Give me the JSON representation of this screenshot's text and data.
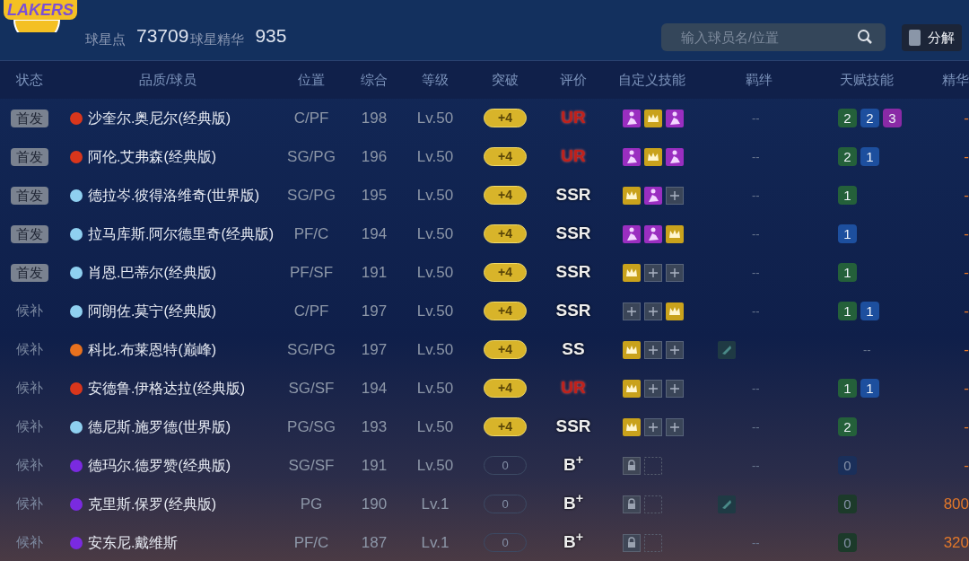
{
  "header": {
    "logo_text": "LAKERS",
    "points_label": "球星点",
    "points": "73709",
    "essence_label": "球星精华",
    "essence": "935",
    "search": {
      "placeholder": "输入球员名/位置"
    },
    "decompose_button": "分解"
  },
  "columns": [
    "状态",
    "品质/球员",
    "位置",
    "综合",
    "等级",
    "突破",
    "评价",
    "自定义技能",
    "羁绊",
    "天赋技能",
    "精华"
  ],
  "rows": [
    {
      "status": "首发",
      "starter": true,
      "color": "#d9361c",
      "name": "沙奎尔.奥尼尔(经典版)",
      "position": "C/PF",
      "overall": "198",
      "level": "Lv.50",
      "breakthrough": "+4",
      "maxed": true,
      "rating": "UR",
      "red": true,
      "skills": [
        {
          "kind": "purple"
        },
        {
          "kind": "gold"
        },
        {
          "kind": "purple"
        }
      ],
      "bond": {
        "kind": "text",
        "text": "--"
      },
      "talents": [
        {
          "text": "2",
          "color": "#24603a"
        },
        {
          "text": "2",
          "color": "#1d4f9e"
        },
        {
          "text": "3",
          "color": "#8a2aa6"
        }
      ],
      "essence": "-"
    },
    {
      "status": "首发",
      "starter": true,
      "color": "#d9361c",
      "name": "阿伦.艾弗森(经典版)",
      "position": "SG/PG",
      "overall": "196",
      "level": "Lv.50",
      "breakthrough": "+4",
      "maxed": true,
      "rating": "UR",
      "red": true,
      "skills": [
        {
          "kind": "purple"
        },
        {
          "kind": "gold"
        },
        {
          "kind": "purple"
        }
      ],
      "bond": {
        "kind": "text",
        "text": "--"
      },
      "talents": [
        {
          "text": "2",
          "color": "#24603a"
        },
        {
          "text": "1",
          "color": "#1d4f9e"
        }
      ],
      "essence": "-"
    },
    {
      "status": "首发",
      "starter": true,
      "color": "#8fd0f0",
      "name": "德拉岑.彼得洛维奇(世界版)",
      "position": "SG/PG",
      "overall": "195",
      "level": "Lv.50",
      "breakthrough": "+4",
      "maxed": true,
      "rating": "SSR",
      "red": false,
      "skills": [
        {
          "kind": "gold"
        },
        {
          "kind": "purple"
        },
        {
          "kind": "empty"
        }
      ],
      "bond": {
        "kind": "text",
        "text": "--"
      },
      "talents": [
        {
          "text": "1",
          "color": "#24603a"
        }
      ],
      "essence": "-"
    },
    {
      "status": "首发",
      "starter": true,
      "color": "#8fd0f0",
      "name": "拉马库斯.阿尔德里奇(经典版)",
      "position": "PF/C",
      "overall": "194",
      "level": "Lv.50",
      "breakthrough": "+4",
      "maxed": true,
      "rating": "SSR",
      "red": false,
      "skills": [
        {
          "kind": "purple"
        },
        {
          "kind": "purple"
        },
        {
          "kind": "gold"
        }
      ],
      "bond": {
        "kind": "text",
        "text": "--"
      },
      "talents": [
        {
          "text": "1",
          "color": "#1d4f9e"
        }
      ],
      "essence": "-"
    },
    {
      "status": "首发",
      "starter": true,
      "color": "#8fd0f0",
      "name": "肖恩.巴蒂尔(经典版)",
      "position": "PF/SF",
      "overall": "191",
      "level": "Lv.50",
      "breakthrough": "+4",
      "maxed": true,
      "rating": "SSR",
      "red": false,
      "skills": [
        {
          "kind": "gold"
        },
        {
          "kind": "empty"
        },
        {
          "kind": "empty"
        }
      ],
      "bond": {
        "kind": "text",
        "text": "--"
      },
      "talents": [
        {
          "text": "1",
          "color": "#24603a"
        }
      ],
      "essence": "-"
    },
    {
      "status": "候补",
      "starter": false,
      "color": "#8fd0f0",
      "name": "阿朗佐.莫宁(经典版)",
      "position": "C/PF",
      "overall": "197",
      "level": "Lv.50",
      "breakthrough": "+4",
      "maxed": true,
      "rating": "SSR",
      "red": false,
      "skills": [
        {
          "kind": "empty"
        },
        {
          "kind": "empty"
        },
        {
          "kind": "gold"
        }
      ],
      "bond": {
        "kind": "text",
        "text": "--"
      },
      "talents": [
        {
          "text": "1",
          "color": "#24603a"
        },
        {
          "text": "1",
          "color": "#1d4f9e"
        }
      ],
      "essence": "-"
    },
    {
      "status": "候补",
      "starter": false,
      "color": "#e8711e",
      "name": "科比.布莱恩特(巅峰)",
      "position": "SG/PG",
      "overall": "197",
      "level": "Lv.50",
      "breakthrough": "+4",
      "maxed": true,
      "rating": "SS",
      "red": false,
      "skills": [
        {
          "kind": "gold"
        },
        {
          "kind": "empty"
        },
        {
          "kind": "empty"
        }
      ],
      "bond": {
        "kind": "icon"
      },
      "talents": [],
      "talent_text": "--",
      "essence": "-"
    },
    {
      "status": "候补",
      "starter": false,
      "color": "#d9361c",
      "name": "安德鲁.伊格达拉(经典版)",
      "position": "SG/SF",
      "overall": "194",
      "level": "Lv.50",
      "breakthrough": "+4",
      "maxed": true,
      "rating": "UR",
      "red": true,
      "skills": [
        {
          "kind": "gold"
        },
        {
          "kind": "empty"
        },
        {
          "kind": "empty"
        }
      ],
      "bond": {
        "kind": "text",
        "text": "--"
      },
      "talents": [
        {
          "text": "1",
          "color": "#24603a"
        },
        {
          "text": "1",
          "color": "#1d4f9e"
        }
      ],
      "essence": "-"
    },
    {
      "status": "候补",
      "starter": false,
      "color": "#8fd0f0",
      "name": "德尼斯.施罗德(世界版)",
      "position": "PG/SG",
      "overall": "193",
      "level": "Lv.50",
      "breakthrough": "+4",
      "maxed": true,
      "rating": "SSR",
      "red": false,
      "skills": [
        {
          "kind": "gold"
        },
        {
          "kind": "empty"
        },
        {
          "kind": "empty"
        }
      ],
      "bond": {
        "kind": "text",
        "text": "--"
      },
      "talents": [
        {
          "text": "2",
          "color": "#24603a"
        }
      ],
      "essence": "-"
    },
    {
      "status": "候补",
      "starter": false,
      "color": "#7a2ae0",
      "name": "德玛尔.德罗赞(经典版)",
      "position": "SG/SF",
      "overall": "191",
      "level": "Lv.50",
      "breakthrough": "0",
      "maxed": false,
      "rating": "B$^{+}$",
      "red": false,
      "skills": [
        {
          "kind": "locked"
        },
        {
          "kind": "dashed"
        }
      ],
      "bond": {
        "kind": "text",
        "text": "--"
      },
      "talents": [
        {
          "text": "0",
          "color": "#1a2f5a"
        }
      ],
      "essence": "-"
    },
    {
      "status": "候补",
      "starter": false,
      "color": "#7a2ae0",
      "name": "克里斯.保罗(经典版)",
      "position": "PG",
      "overall": "190",
      "level": "Lv.1",
      "breakthrough": "0",
      "maxed": false,
      "rating": "B$^{+}$",
      "red": false,
      "skills": [
        {
          "kind": "locked"
        },
        {
          "kind": "dashed"
        }
      ],
      "bond": {
        "kind": "icon"
      },
      "talents": [
        {
          "text": "0",
          "color": "#1c3a2a"
        }
      ],
      "essence": "800"
    },
    {
      "status": "候补",
      "starter": false,
      "color": "#7a2ae0",
      "name": "安东尼.戴维斯",
      "position": "PF/C",
      "overall": "187",
      "level": "Lv.1",
      "breakthrough": "0",
      "maxed": false,
      "rating": "B$^{+}$",
      "red": false,
      "skills": [
        {
          "kind": "locked"
        },
        {
          "kind": "dashed"
        }
      ],
      "bond": {
        "kind": "text",
        "text": "--"
      },
      "talents": [
        {
          "text": "0",
          "color": "#1c3a2a"
        }
      ],
      "essence": "320"
    }
  ]
}
